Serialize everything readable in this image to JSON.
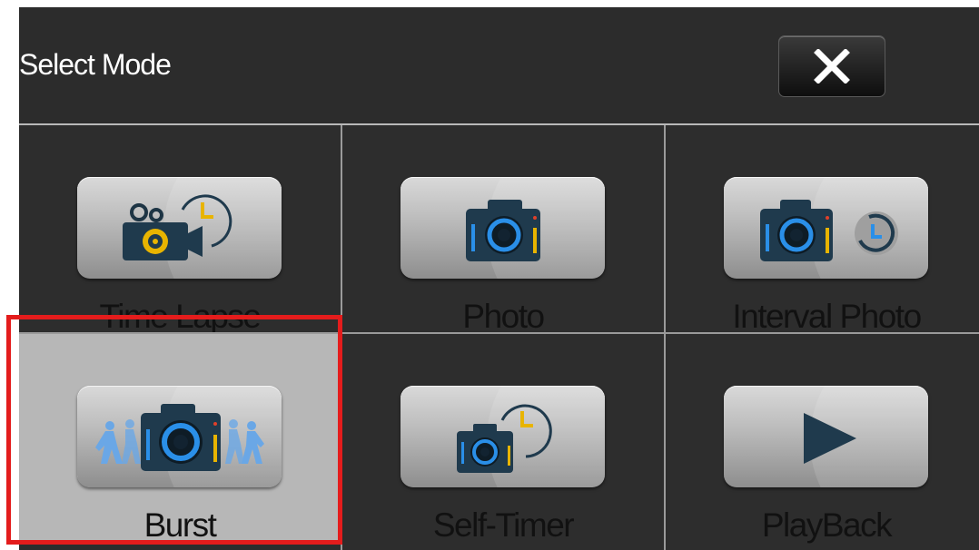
{
  "header": {
    "title": "Select Mode",
    "close_icon": "close-icon"
  },
  "modes": [
    {
      "label": "Time Lapse",
      "icon": "timelapse-icon",
      "selected": false
    },
    {
      "label": "Photo",
      "icon": "camera-icon",
      "selected": false
    },
    {
      "label": "Interval Photo",
      "icon": "interval-camera-icon",
      "selected": false
    },
    {
      "label": "Burst",
      "icon": "burst-icon",
      "selected": true
    },
    {
      "label": "Self-Timer",
      "icon": "self-timer-icon",
      "selected": false
    },
    {
      "label": "PlayBack",
      "icon": "play-icon",
      "selected": false
    }
  ],
  "colors": {
    "background": "#2d2d2d",
    "selected_tile": "#b7b7b7",
    "highlight_border": "#e41c1c",
    "icon_blue": "#2a8fe8",
    "icon_yellow": "#e8b400"
  }
}
